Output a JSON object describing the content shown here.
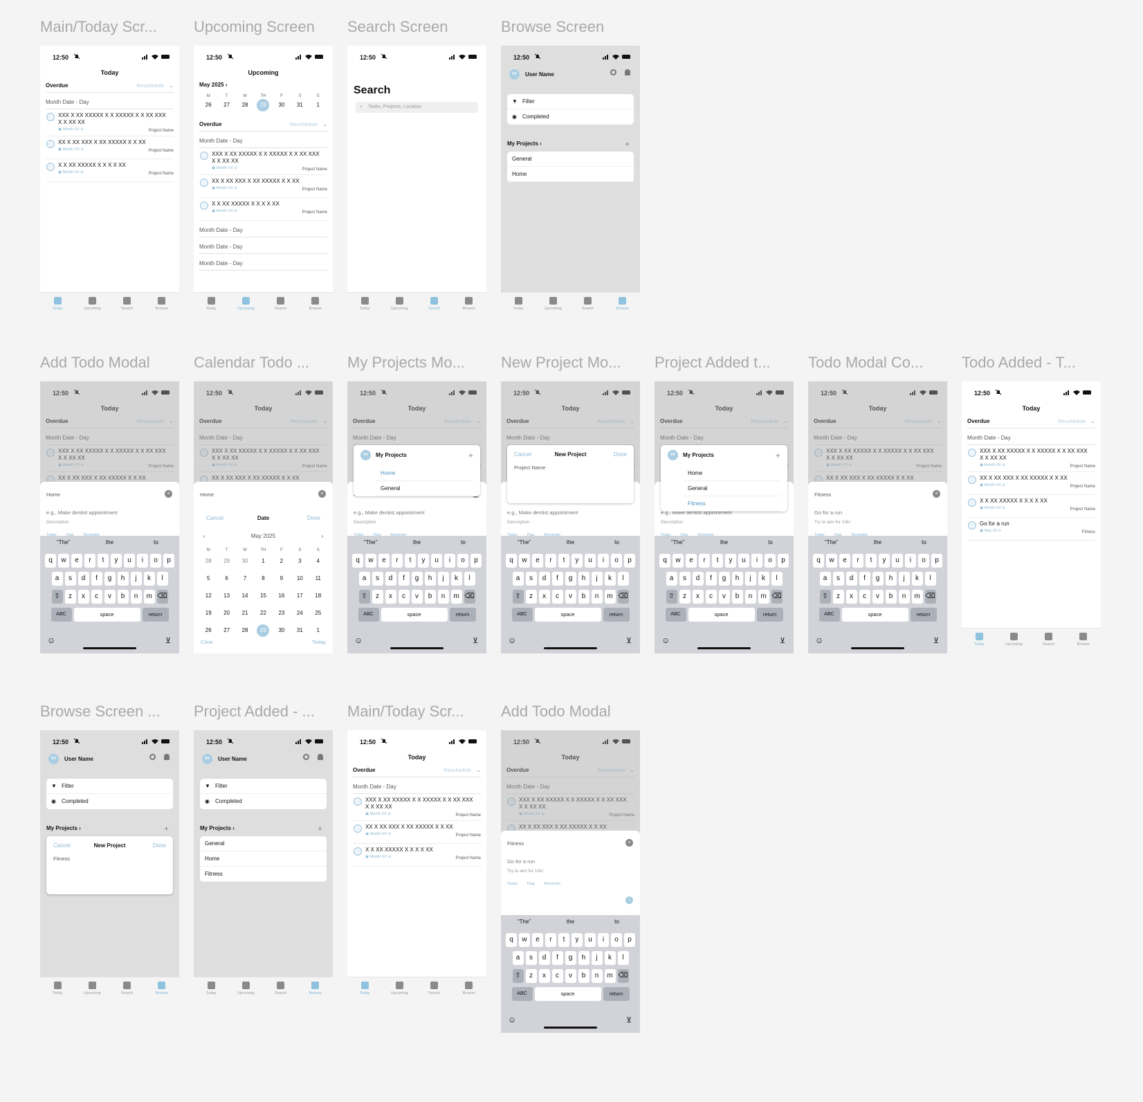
{
  "titles": {
    "f1": "Main/Today Scr...",
    "f2": "Upcoming Screen",
    "f3": "Search Screen",
    "f4": "Browse Screen",
    "f5": "Add Todo Modal",
    "f6": "Calendar Todo ...",
    "f7": "My Projects Mo...",
    "f8": "New Project Mo...",
    "f9": "Project Added t...",
    "f10": "Todo Modal Co...",
    "f11": "Todo Added - T...",
    "f12": "Browse Screen ...",
    "f13": "Project Added - ...",
    "f14": "Main/Today Scr...",
    "f15": "Add Todo Modal"
  },
  "status": {
    "time": "12:50"
  },
  "today": {
    "title": "Today",
    "overdue": "Overdue",
    "reschedule": "Reschedule",
    "section": "Month Date - Day",
    "tasks": [
      {
        "text": "XXX X XX XXXXX X X XXXXX X X XX XXX X X XX XX",
        "date": "Month XX",
        "project": "Project Name"
      },
      {
        "text": "XX X XX XXX X XX XXXXX X X XX",
        "date": "Month XX",
        "project": "Project Name"
      },
      {
        "text": "X X XX XXXXX X X  X X XX",
        "date": "Month XX",
        "project": "Project Name"
      }
    ],
    "added": {
      "text": "Go for a run",
      "date": "May 29",
      "project": "Fitness"
    }
  },
  "upcoming": {
    "title": "Upcoming",
    "month": "May 2025",
    "weekdays": [
      "M",
      "T",
      "W",
      "TH",
      "F",
      "S",
      "S"
    ],
    "days": [
      "26",
      "27",
      "28",
      "29",
      "30",
      "31",
      "1"
    ],
    "more": [
      "Month Date - Day",
      "Month Date - Day",
      "Month Date - Day"
    ]
  },
  "search": {
    "title": "Search",
    "placeholder": "Tasks, Projects, Location"
  },
  "browse": {
    "user": "User Name",
    "avatar": "XX",
    "filter": "Filter",
    "completed": "Completed",
    "my_projects": "My Projects",
    "projects": [
      "General",
      "Home"
    ],
    "projects_added": [
      "General",
      "Home",
      "Fitness"
    ]
  },
  "tabs": [
    "Today",
    "Upcoming",
    "Search",
    "Browse"
  ],
  "modal": {
    "project": "Home",
    "placeholder": "e.g., Make dentist appointment",
    "description": "Description",
    "opt_today": "Today",
    "opt_flag": "Flag",
    "opt_reminder": "Reminder",
    "fitness_project": "Fitness",
    "fitness_task": "Go for a run",
    "fitness_desc": "Try to aim for 10k!"
  },
  "keyboard": {
    "sugg": [
      "“The”",
      "the",
      "to"
    ],
    "row1": [
      "q",
      "w",
      "e",
      "r",
      "t",
      "y",
      "u",
      "i",
      "o",
      "p"
    ],
    "row2": [
      "a",
      "s",
      "d",
      "f",
      "g",
      "h",
      "j",
      "k",
      "l"
    ],
    "row3": [
      "z",
      "x",
      "c",
      "v",
      "b",
      "n",
      "m"
    ],
    "abc": "ABC",
    "space": "space",
    "return": "return"
  },
  "calendar": {
    "cancel": "Cancel",
    "title": "Date",
    "done": "Done",
    "month": "May 2025",
    "weekdays": [
      "M",
      "T",
      "W",
      "TH",
      "F",
      "S",
      "S"
    ],
    "weeks": [
      [
        "28",
        "29",
        "30",
        "1",
        "2",
        "3",
        "4"
      ],
      [
        "5",
        "6",
        "7",
        "8",
        "9",
        "10",
        "11"
      ],
      [
        "12",
        "13",
        "14",
        "15",
        "16",
        "17",
        "18"
      ],
      [
        "19",
        "20",
        "21",
        "22",
        "23",
        "24",
        "25"
      ],
      [
        "26",
        "27",
        "28",
        "29",
        "30",
        "31",
        "1"
      ]
    ],
    "clear": "Clear",
    "today": "Today"
  },
  "projects_modal": {
    "title": "My Projects",
    "items": [
      "Home",
      "General"
    ],
    "items_added": [
      "Home",
      "General",
      "Fitness"
    ]
  },
  "new_project": {
    "cancel": "Cancel",
    "title": "New Project",
    "done": "Done",
    "placeholder": "Project Name",
    "value": "Fitness"
  }
}
